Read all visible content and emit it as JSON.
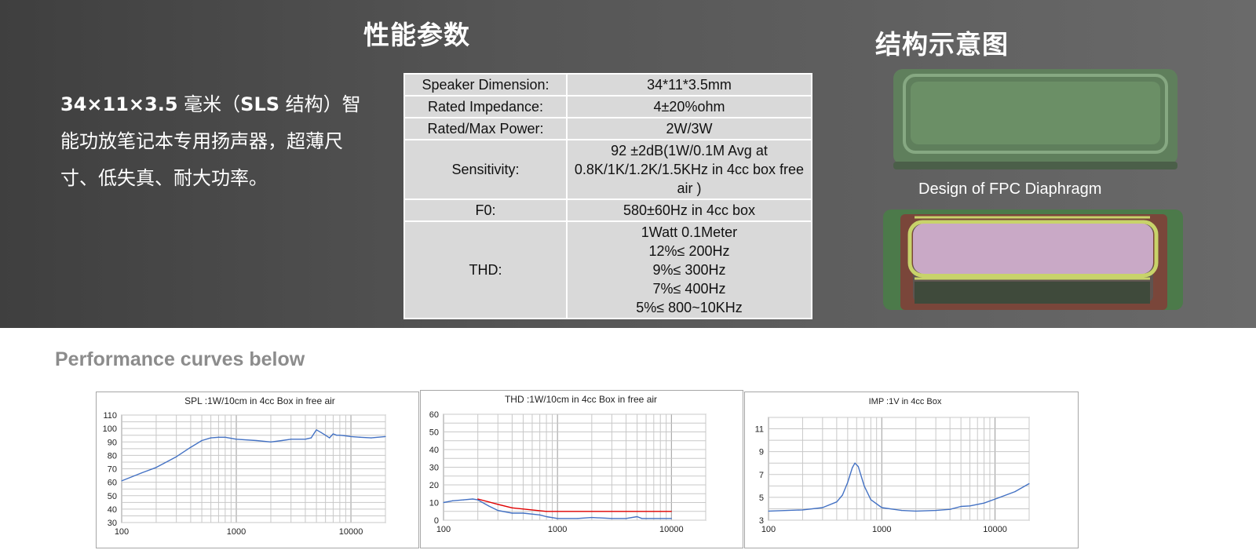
{
  "header": {
    "performance_title": "性能参数",
    "structure_title": "结构示意图"
  },
  "intro": {
    "bold_size": "34×11×3.5",
    "text_1": " 毫米（",
    "bold_sls": "SLS",
    "text_2": " 结构）智能功放笔记本专用扬声器，超薄尺寸、低失真、耐大功率。"
  },
  "spec_table": {
    "rows": [
      {
        "label": "Speaker Dimension:",
        "value": [
          "34*11*3.5mm"
        ]
      },
      {
        "label": "Rated Impedance:",
        "value": [
          "4±20%ohm"
        ]
      },
      {
        "label": "Rated/Max Power:",
        "value": [
          "2W/3W"
        ]
      },
      {
        "label": "Sensitivity:",
        "value": [
          "92 ±2dB(1W/0.1M Avg at",
          "0.8K/1K/1.2K/1.5KHz in 4cc box  free",
          "air )"
        ]
      },
      {
        "label": "F0:",
        "value": [
          "580±60Hz in 4cc box"
        ]
      },
      {
        "label": "THD:",
        "value": [
          "1Watt 0.1Meter",
          "12%≤  200Hz",
          "9%≤  300Hz",
          "7%≤  400Hz",
          "5%≤  800~10KHz"
        ]
      }
    ]
  },
  "structure": {
    "fpc_label": "Design of FPC Diaphragm",
    "top_colors": {
      "frame": "#5f7f5c",
      "edge": "#7c2a2a",
      "inner": "#6b8f66"
    },
    "bottom_colors": {
      "frame": "#4c7a4a",
      "edge": "#8a3636",
      "diaphragm": "#c9a9c6",
      "rail": "#c8d36a"
    }
  },
  "performance": {
    "title": "Performance curves below"
  },
  "chart_data": [
    {
      "type": "line",
      "title": "SPL :1W/10cm in 4cc Box in free air",
      "xscale": "log",
      "xlim": [
        100,
        20000
      ],
      "xticks": [
        "100",
        "1000",
        "10000"
      ],
      "ylim": [
        30,
        110
      ],
      "yticks": [
        "30",
        "40",
        "50",
        "60",
        "70",
        "80",
        "90",
        "100",
        "110"
      ],
      "grid": true,
      "series": [
        {
          "color": "#4472c4",
          "x": [
            100,
            150,
            200,
            300,
            400,
            500,
            600,
            700,
            800,
            1000,
            1500,
            2000,
            2500,
            3000,
            4000,
            4500,
            5000,
            5500,
            6000,
            6500,
            7000,
            7500,
            8000,
            9000,
            10000,
            12000,
            15000,
            20000
          ],
          "y": [
            61,
            67,
            71,
            79,
            86,
            91,
            93,
            93.5,
            93.5,
            92,
            91,
            90,
            91,
            92,
            92,
            93,
            99,
            97,
            95,
            93,
            96,
            95,
            95,
            94.5,
            94,
            93.5,
            93,
            94
          ]
        }
      ]
    },
    {
      "type": "line",
      "title": "THD :1W/10cm in 4cc Box in free air",
      "xscale": "log",
      "xlim": [
        100,
        20000
      ],
      "xticks": [
        "100",
        "1000",
        "10000"
      ],
      "ylim": [
        0,
        60
      ],
      "yticks": [
        "0",
        "10",
        "20",
        "30",
        "40",
        "50",
        "60"
      ],
      "grid": true,
      "series": [
        {
          "color": "#4472c4",
          "x": [
            100,
            120,
            150,
            180,
            200,
            250,
            300,
            400,
            500,
            700,
            800,
            1000,
            1500,
            2000,
            3000,
            4000,
            5000,
            5500,
            6000,
            8000,
            10000
          ],
          "y": [
            10,
            11,
            11.5,
            12,
            11.5,
            8,
            5.5,
            4,
            4,
            3,
            2,
            1,
            1,
            1.5,
            1,
            1,
            2,
            1,
            1,
            1,
            1
          ]
        },
        {
          "color": "#e00000",
          "x": [
            200,
            300,
            400,
            800,
            10000
          ],
          "y": [
            12,
            9,
            7,
            5,
            5
          ]
        }
      ]
    },
    {
      "type": "line",
      "title": "IMP :1V in 4cc Box",
      "xscale": "log",
      "xlim": [
        100,
        20000
      ],
      "xticks": [
        "100",
        "1000",
        "10000"
      ],
      "ylim": [
        3,
        12
      ],
      "yticks": [
        "3",
        "5",
        "7",
        "9",
        "11"
      ],
      "grid": true,
      "series": [
        {
          "color": "#4472c4",
          "x": [
            100,
            200,
            300,
            400,
            450,
            500,
            550,
            580,
            620,
            700,
            800,
            1000,
            1500,
            2000,
            3000,
            4000,
            5000,
            6000,
            8000,
            10000,
            15000,
            20000
          ],
          "y": [
            3.8,
            3.9,
            4.1,
            4.6,
            5.2,
            6.3,
            7.6,
            8.0,
            7.7,
            6.0,
            4.8,
            4.1,
            3.85,
            3.8,
            3.85,
            3.95,
            4.2,
            4.25,
            4.5,
            4.85,
            5.5,
            6.2
          ]
        }
      ]
    }
  ]
}
